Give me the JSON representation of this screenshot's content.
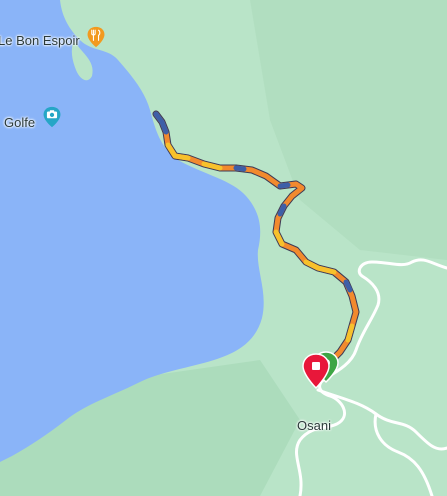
{
  "map": {
    "colors": {
      "land": "#b9e4c8",
      "water": "#8ab4f8",
      "road": "#ffffff",
      "route_orange": "#f28a2e",
      "route_yellow": "#f7c12c",
      "route_blue": "#3e5fa8",
      "end_pin": "#e8173a",
      "start_pin": "#3ea645",
      "poi_restaurant": "#f29a1f",
      "poi_viewpoint": "#26a6c6"
    },
    "places": [
      {
        "id": "le-bon-espoir",
        "name": "Le Bon Espoir",
        "icon": "restaurant-icon"
      },
      {
        "id": "golfe",
        "name": "Golfe",
        "icon": "camera-icon"
      },
      {
        "id": "osani",
        "name": "Osani",
        "icon": ""
      }
    ],
    "route": {
      "start_marker": "start-pin-icon",
      "end_marker": "end-pin-icon"
    }
  }
}
